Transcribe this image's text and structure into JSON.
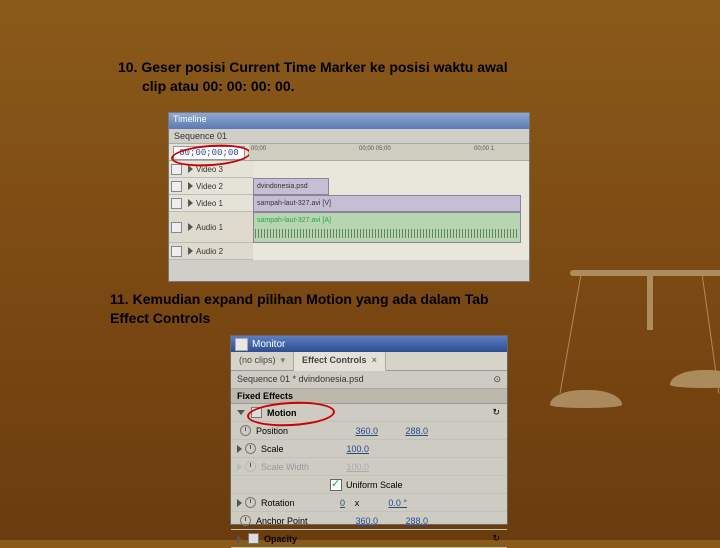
{
  "step10": {
    "num": "10. ",
    "text": "Geser posisi Current Time Marker ke posisi waktu awal",
    "text2": "clip atau 00: 00: 00: 00."
  },
  "step11": {
    "num": "11. ",
    "text": "Kemudian expand pilihan Motion yang ada dalam Tab",
    "text2": "Effect Controls"
  },
  "timeline": {
    "title": "Timeline",
    "seq": "Sequence 01",
    "timecode": "00;00;00;00",
    "ticks": [
      "00;00",
      "00;00 05;00",
      "00;00 1"
    ],
    "tracks": [
      "Video 3",
      "Video 2",
      "Video 1",
      "Audio 1",
      "Audio 2"
    ],
    "clip_v2": "dvindonesia.psd",
    "clip_v1": "sampah-laut-327.avi [V]",
    "clip_a1": "sampah-laut-327.avi [A]"
  },
  "ec": {
    "title": "Monitor",
    "tab1": "(no clips)",
    "tab2": "Effect Controls",
    "seq": "Sequence 01 * dvindonesia.psd",
    "fixed": "Fixed Effects",
    "motion": "Motion",
    "rows": [
      {
        "label": "Position",
        "v1": "360.0",
        "v2": "288.0"
      },
      {
        "label": "Scale",
        "v1": "100.0",
        "v2": ""
      },
      {
        "label": "Scale Width",
        "v1": "100.0",
        "v2": ""
      }
    ],
    "uniform": "Uniform Scale",
    "rows2": [
      {
        "label": "Rotation",
        "v1": "0",
        "v2": "0.0 °",
        "sep": "x"
      },
      {
        "label": "Anchor Point",
        "v1": "360.0",
        "v2": "288.0"
      }
    ],
    "opacity": "Opacity"
  }
}
